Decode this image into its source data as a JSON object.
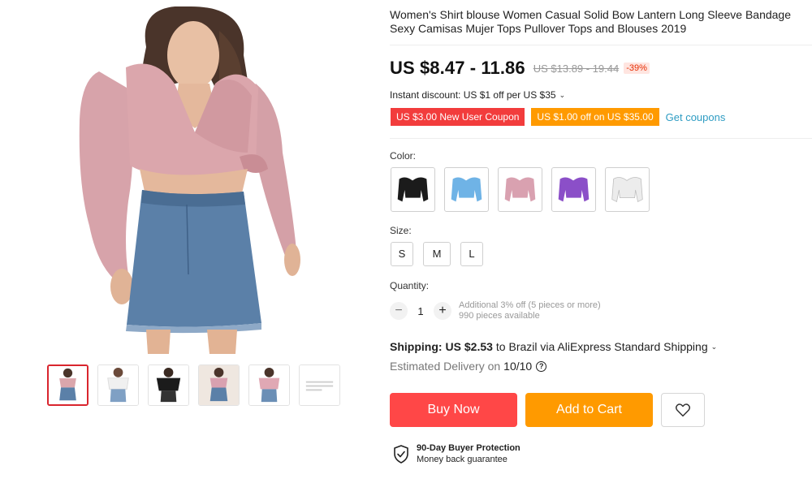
{
  "product": {
    "title": "Women's Shirt blouse Women Casual Solid Bow Lantern Long Sleeve Bandage Sexy Camisas Mujer Tops Pullover Tops and Blouses 2019"
  },
  "price": {
    "current": "US $8.47 - 11.86",
    "original": "US $13.89 - 19.44",
    "discount": "-39%"
  },
  "discount": {
    "instant": "Instant discount: US $1 off per US $35"
  },
  "coupons": {
    "items": [
      {
        "label": "US $3.00 New User Coupon",
        "color": "#f23c3c"
      },
      {
        "label": "US $1.00 off on US $35.00",
        "color": "#ff9a00"
      }
    ],
    "get_label": "Get coupons"
  },
  "color": {
    "label": "Color:",
    "options": [
      {
        "name": "black",
        "hex": "#1b1b1b"
      },
      {
        "name": "blue",
        "hex": "#6fb3e6"
      },
      {
        "name": "pink",
        "hex": "#d9a1b0"
      },
      {
        "name": "purple",
        "hex": "#8b4fc8"
      },
      {
        "name": "white",
        "hex": "#ececec"
      }
    ]
  },
  "size": {
    "label": "Size:",
    "options": [
      "S",
      "M",
      "L"
    ]
  },
  "quantity": {
    "label": "Quantity:",
    "value": "1",
    "note": "Additional 3% off (5 pieces or more)",
    "available": "990 pieces available"
  },
  "shipping": {
    "label": "Shipping:",
    "cost": "US $2.53",
    "detail": "to Brazil via AliExpress Standard Shipping",
    "delivery_prefix": "Estimated Delivery on",
    "delivery_date": "10/10"
  },
  "actions": {
    "buy_now": "Buy Now",
    "add_to_cart": "Add to Cart"
  },
  "protection": {
    "title": "90-Day Buyer Protection",
    "subtitle": "Money back guarantee"
  },
  "colors": {
    "accent_red": "#ff4747",
    "accent_orange": "#ff9a00",
    "link_blue": "#2e9cc3"
  }
}
